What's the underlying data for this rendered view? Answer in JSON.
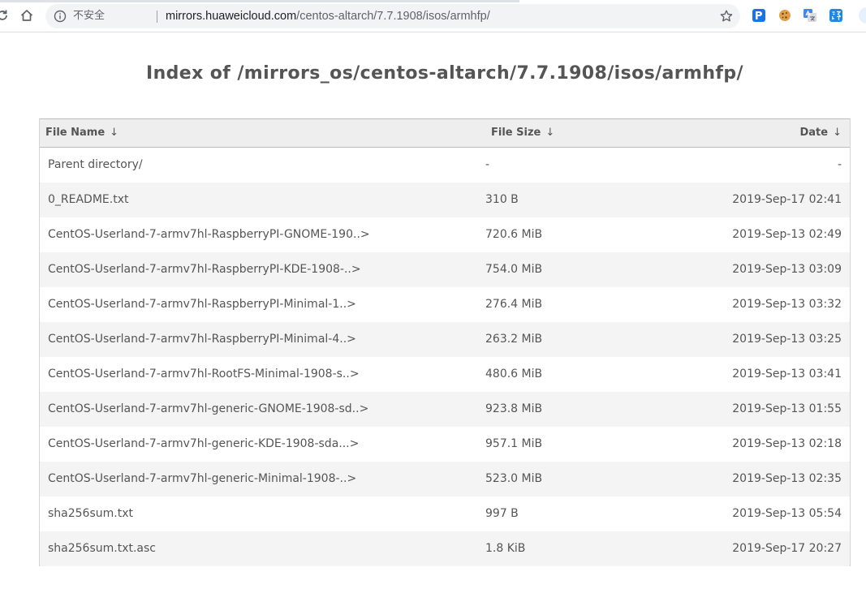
{
  "browser": {
    "security_label": "不安全",
    "url_host": "mirrors.huaweicloud.com",
    "url_path": "/centos-altarch/7.7.1908/isos/armhfp/"
  },
  "page": {
    "title": "Index of /mirrors_os/centos-altarch/7.7.1908/isos/armhfp/"
  },
  "table": {
    "headers": {
      "name": "File Name",
      "size": "File Size",
      "date": "Date",
      "sort_arrow": "↓"
    },
    "rows": [
      {
        "name": "Parent directory/",
        "size": "-",
        "date": "-"
      },
      {
        "name": "0_README.txt",
        "size": "310 B",
        "date": "2019-Sep-17 02:41"
      },
      {
        "name": "CentOS-Userland-7-armv7hl-RaspberryPI-GNOME-190..>",
        "size": "720.6 MiB",
        "date": "2019-Sep-13 02:49"
      },
      {
        "name": "CentOS-Userland-7-armv7hl-RaspberryPI-KDE-1908-..>",
        "size": "754.0 MiB",
        "date": "2019-Sep-13 03:09"
      },
      {
        "name": "CentOS-Userland-7-armv7hl-RaspberryPI-Minimal-1..>",
        "size": "276.4 MiB",
        "date": "2019-Sep-13 03:32"
      },
      {
        "name": "CentOS-Userland-7-armv7hl-RaspberryPI-Minimal-4..>",
        "size": "263.2 MiB",
        "date": "2019-Sep-13 03:25"
      },
      {
        "name": "CentOS-Userland-7-armv7hl-RootFS-Minimal-1908-s..>",
        "size": "480.6 MiB",
        "date": "2019-Sep-13 03:41"
      },
      {
        "name": "CentOS-Userland-7-armv7hl-generic-GNOME-1908-sd..>",
        "size": "923.8 MiB",
        "date": "2019-Sep-13 01:55"
      },
      {
        "name": "CentOS-Userland-7-armv7hl-generic-KDE-1908-sda...>",
        "size": "957.1 MiB",
        "date": "2019-Sep-13 02:18"
      },
      {
        "name": "CentOS-Userland-7-armv7hl-generic-Minimal-1908-..>",
        "size": "523.0 MiB",
        "date": "2019-Sep-13 02:35"
      },
      {
        "name": "sha256sum.txt",
        "size": "997 B",
        "date": "2019-Sep-13 05:54"
      },
      {
        "name": "sha256sum.txt.asc",
        "size": "1.8 KiB",
        "date": "2019-Sep-17 20:27"
      }
    ]
  },
  "icons": {
    "reload": "reload-icon",
    "home": "home-icon",
    "info": "info-icon",
    "bookmark": "star-icon",
    "extensions": [
      "extension-p-icon",
      "cookie-icon",
      "translate-icon",
      "translator-yi-icon"
    ]
  },
  "colors": {
    "page_text": "#555555",
    "header_bg": "#eeeeee",
    "stripe_bg": "#f4f4f4"
  }
}
